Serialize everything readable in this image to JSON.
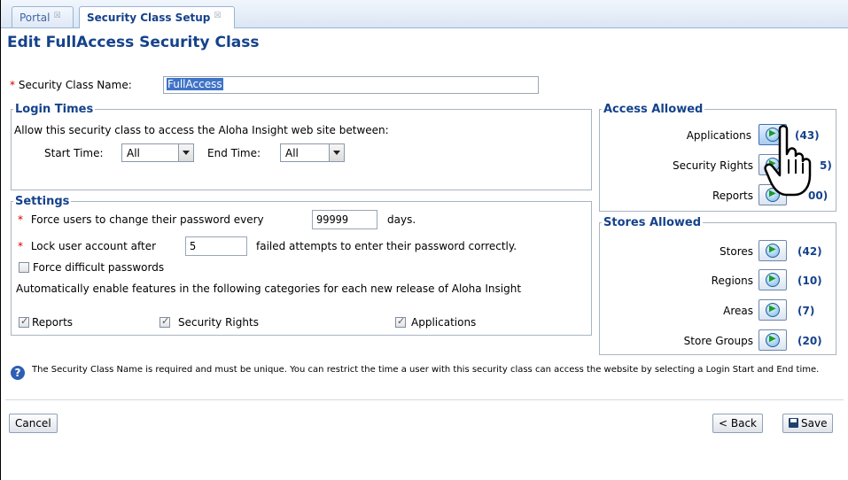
{
  "tabs": [
    {
      "label": "Portal"
    },
    {
      "label": "Security Class Setup"
    }
  ],
  "page_title": "Edit FullAccess Security Class",
  "security_class_name": {
    "label": "Security Class Name:",
    "value": "FullAccess"
  },
  "login_times": {
    "legend": "Login Times",
    "description": "Allow this security class to access the Aloha Insight web site between:",
    "start_label": "Start Time:",
    "start_value": "All",
    "end_label": "End Time:",
    "end_value": "All"
  },
  "settings": {
    "legend": "Settings",
    "password_prefix": "Force users to change their password every",
    "password_days": "99999",
    "password_suffix": "days.",
    "lock_prefix": "Lock user account after",
    "lock_attempts": "5",
    "lock_suffix": "failed attempts to enter their password correctly.",
    "difficult_label": "Force difficult passwords",
    "auto_enable_text": "Automatically enable features in the following categories for each new release of Aloha Insight",
    "categories": [
      {
        "label": "Reports",
        "checked": true
      },
      {
        "label": "Security Rights",
        "checked": true
      },
      {
        "label": "Applications",
        "checked": true
      }
    ]
  },
  "access_allowed": {
    "legend": "Access Allowed",
    "items": [
      {
        "label": "Applications",
        "count": "(43)"
      },
      {
        "label": "Security Rights",
        "count": "5)"
      },
      {
        "label": "Reports",
        "count": "00)"
      }
    ]
  },
  "stores_allowed": {
    "legend": "Stores Allowed",
    "items": [
      {
        "label": "Stores",
        "count": "(42)"
      },
      {
        "label": "Regions",
        "count": "(10)"
      },
      {
        "label": "Areas",
        "count": "(7)"
      },
      {
        "label": "Store Groups",
        "count": "(20)"
      }
    ]
  },
  "info_text": "The Security Class Name is required and must be unique. You can restrict the time a user with this security class can access the website by selecting a Login Start and End time.",
  "buttons": {
    "cancel": "Cancel",
    "back": "< Back",
    "save": "Save"
  },
  "colors": {
    "title_blue": "#15428b",
    "required_red": "#d10000",
    "accent_green": "#1a9b2a"
  },
  "icons": [
    "tab-close-icon",
    "select-arrow-icon",
    "arrow-right-circle-icon",
    "info-icon",
    "save-floppy-icon",
    "hand-pointer-cursor"
  ]
}
